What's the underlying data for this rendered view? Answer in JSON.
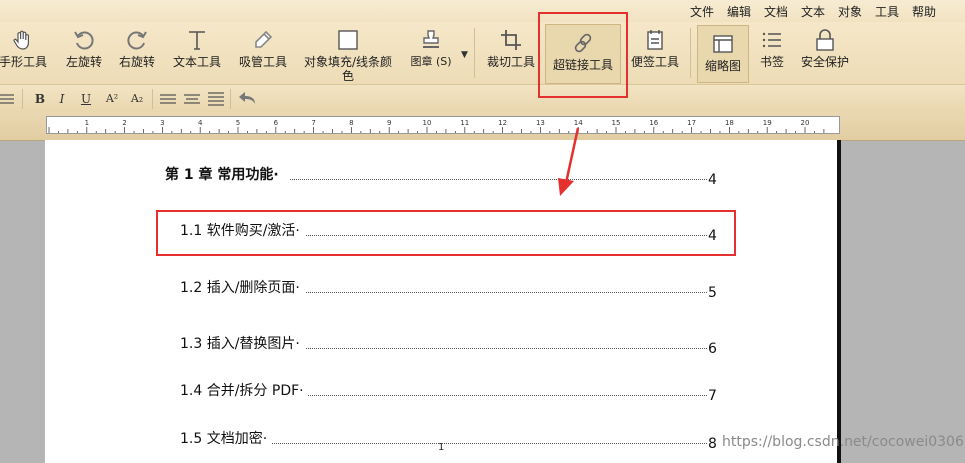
{
  "menu": [
    "文件",
    "编辑",
    "文档",
    "文本",
    "对象",
    "工具",
    "帮助"
  ],
  "tools": [
    {
      "name": "hand-tool",
      "label": "手形工具",
      "icon": "hand-icon"
    },
    {
      "name": "rotate-left",
      "label": "左旋转",
      "icon": "rotate-left-icon"
    },
    {
      "name": "rotate-right",
      "label": "右旋转",
      "icon": "rotate-right-icon"
    },
    {
      "name": "text-tool",
      "label": "文本工具",
      "icon": "text-icon"
    },
    {
      "name": "eyedropper-tool",
      "label": "吸管工具",
      "icon": "eyedropper-icon"
    },
    {
      "name": "object-fill",
      "label": "对象填充/线条颜色",
      "icon": "fill-square-icon"
    },
    {
      "name": "stamp",
      "label": "图章 (S)",
      "icon": "stamp-icon"
    },
    {
      "name": "crop-tool",
      "label": "裁切工具",
      "icon": "crop-icon"
    },
    {
      "name": "hyperlink-tool",
      "label": "超链接工具",
      "icon": "link-icon"
    },
    {
      "name": "sticky-note",
      "label": "便签工具",
      "icon": "note-icon"
    },
    {
      "name": "thumbnails",
      "label": "缩略图",
      "icon": "thumbnail-icon"
    },
    {
      "name": "bookmarks",
      "label": "书签",
      "icon": "bookmark-list-icon"
    },
    {
      "name": "security",
      "label": "安全保护",
      "icon": "lock-icon"
    }
  ],
  "format_buttons": [
    "B",
    "I",
    "U",
    "A²",
    "A₂"
  ],
  "ruler_labels": [
    "1",
    "2",
    "3",
    "4",
    "5",
    "6",
    "7",
    "8",
    "9",
    "10",
    "11",
    "12",
    "13",
    "14",
    "15",
    "16",
    "17",
    "18",
    "19",
    "20"
  ],
  "toc": [
    {
      "title": "第 1 章  常用功能·",
      "page": "4",
      "bold": true
    },
    {
      "title": "1.1 软件购买/激活·",
      "page": "4"
    },
    {
      "title": "1.2 插入/删除页面·",
      "page": "5"
    },
    {
      "title": "1.3 插入/替换图片·",
      "page": "6"
    },
    {
      "title": "1.4 合并/拆分 PDF·",
      "page": "7"
    },
    {
      "title": "1.5 文档加密·",
      "page": "8"
    }
  ],
  "page_number": "1",
  "watermark": "https://blog.csdn.net/cocowei0306",
  "colors": {
    "highlight": "#e53030",
    "toolbar": "#f1e2c1"
  }
}
